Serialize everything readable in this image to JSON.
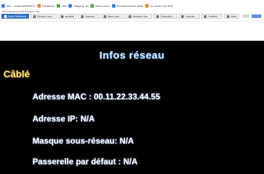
{
  "browser": {
    "bookmarks": [
      {
        "label": "Slot - Lecteur/IHMINFO",
        "icon": "page-icon"
      },
      {
        "label": "Panneaux",
        "icon": "page-icon"
      },
      {
        "label": "Jam",
        "icon": "page-icon"
      },
      {
        "label": "Mapping .pc",
        "icon": "page-icon"
      },
      {
        "label": "Macs cours",
        "icon": "page-icon"
      },
      {
        "label": "Recherchement aussi",
        "icon": "page-icon"
      },
      {
        "label": "un visuel hors tree",
        "icon": "page-icon"
      }
    ],
    "url_text": "http://localhost:3000/index.php",
    "tabs": [
      {
        "label": "Boite Méthode",
        "active": true
      },
      {
        "label": "Recent Vue..."
      },
      {
        "label": "modèle"
      },
      {
        "label": "Sauces..."
      },
      {
        "label": "Menu ma..."
      },
      {
        "label": "Network ma..."
      },
      {
        "label": "Essentiel..."
      },
      {
        "label": "Lecture..."
      },
      {
        "label": "Oreilles..."
      },
      {
        "label": "Infos"
      }
    ]
  },
  "screen": {
    "title": "Infos réseau",
    "section": "Câblé",
    "rows": [
      "Adresse MAC : 00.11.22.33.44.55",
      "Adresse IP: N/A",
      "Masque sous-réseau: N/A",
      "Passerelle par défaut : N/A"
    ]
  },
  "colors": {
    "screen_bg": "#000000",
    "title": "#cfe6ff",
    "section": "#ffe58a",
    "row_text": "#ffffff"
  }
}
